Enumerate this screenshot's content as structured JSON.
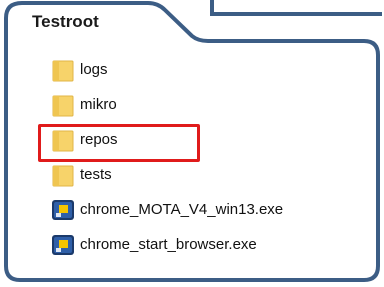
{
  "folder": {
    "title": "Testroot"
  },
  "items": [
    {
      "label": "logs",
      "icon": "folder-icon"
    },
    {
      "label": "mikro",
      "icon": "folder-icon"
    },
    {
      "label": "repos",
      "icon": "folder-icon",
      "highlighted": true
    },
    {
      "label": "tests",
      "icon": "folder-icon"
    },
    {
      "label": "chrome_MOTA_V4_win13.exe",
      "icon": "exe-app-icon"
    },
    {
      "label": "chrome_start_browser.exe",
      "icon": "exe-app-icon"
    }
  ],
  "colors": {
    "frame_border": "#3c5d85",
    "highlight": "#e01b1b",
    "folder_fill": "#f7d36a",
    "folder_edge": "#e0b445"
  }
}
